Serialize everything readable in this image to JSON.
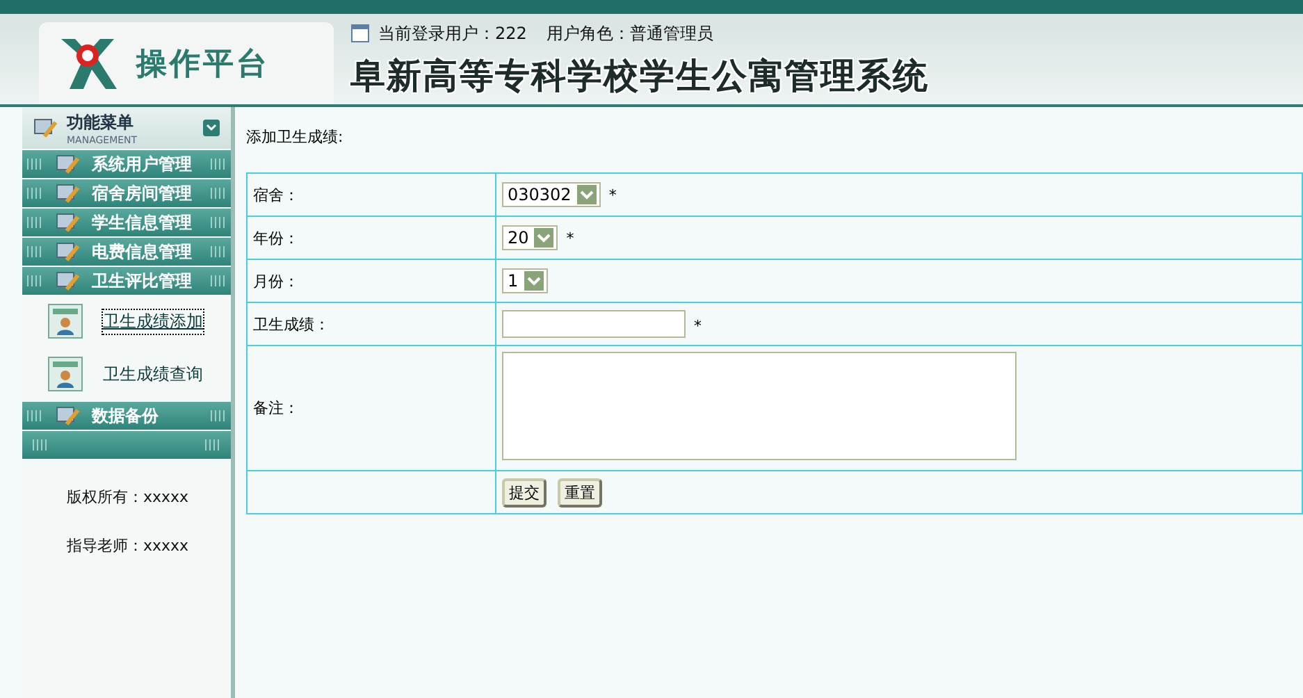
{
  "header": {
    "platform": "操作平台",
    "login_user_label": "当前登录用户：",
    "login_user": "222",
    "role_label": "用户角色：",
    "role": "普通管理员",
    "system_title": "阜新高等专科学校学生公寓管理系统"
  },
  "sidebar": {
    "menu_title": "功能菜单",
    "menu_subtitle": "MANAGEMENT",
    "items": [
      {
        "label": "系统用户管理"
      },
      {
        "label": "宿舍房间管理"
      },
      {
        "label": "学生信息管理"
      },
      {
        "label": "电费信息管理"
      },
      {
        "label": "卫生评比管理",
        "children": [
          {
            "label": "卫生成绩添加",
            "selected": true
          },
          {
            "label": "卫生成绩查询",
            "selected": false
          }
        ]
      },
      {
        "label": "数据备份"
      }
    ],
    "footer": [
      "版权所有：xxxxx",
      "指导老师：xxxxx"
    ]
  },
  "form": {
    "title": "添加卫生成绩:",
    "rows": [
      {
        "kind": "select",
        "label": "宿舍：",
        "value": "030302",
        "mark": "*"
      },
      {
        "kind": "select",
        "label": "年份：",
        "value": "20",
        "mark": "*"
      },
      {
        "kind": "select",
        "label": "月份：",
        "value": "1"
      },
      {
        "kind": "text",
        "label": "卫生成绩：",
        "value": "",
        "mark": "*"
      },
      {
        "kind": "textarea",
        "label": "备注：",
        "value": ""
      },
      {
        "kind": "buttons",
        "buttons": [
          "提交",
          "重置"
        ]
      }
    ]
  }
}
